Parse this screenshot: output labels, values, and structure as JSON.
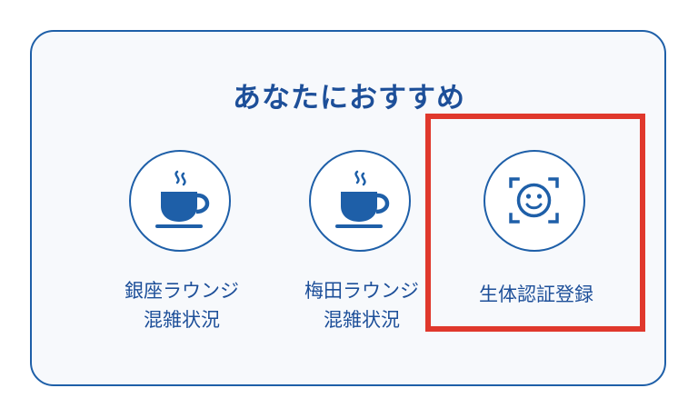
{
  "section": {
    "title": "あなたにおすすめ"
  },
  "tiles": [
    {
      "icon": "coffee-cup-icon",
      "label_line1": "銀座ラウンジ",
      "label_line2": "混雑状況"
    },
    {
      "icon": "coffee-cup-icon",
      "label_line1": "梅田ラウンジ",
      "label_line2": "混雑状況"
    },
    {
      "icon": "face-scan-icon",
      "label_line1": "生体認証登録"
    }
  ],
  "colors": {
    "primary": "#1e5fa8",
    "text": "#1d4f99",
    "highlight": "#e0382c",
    "card_background": "#f7f9fc"
  }
}
